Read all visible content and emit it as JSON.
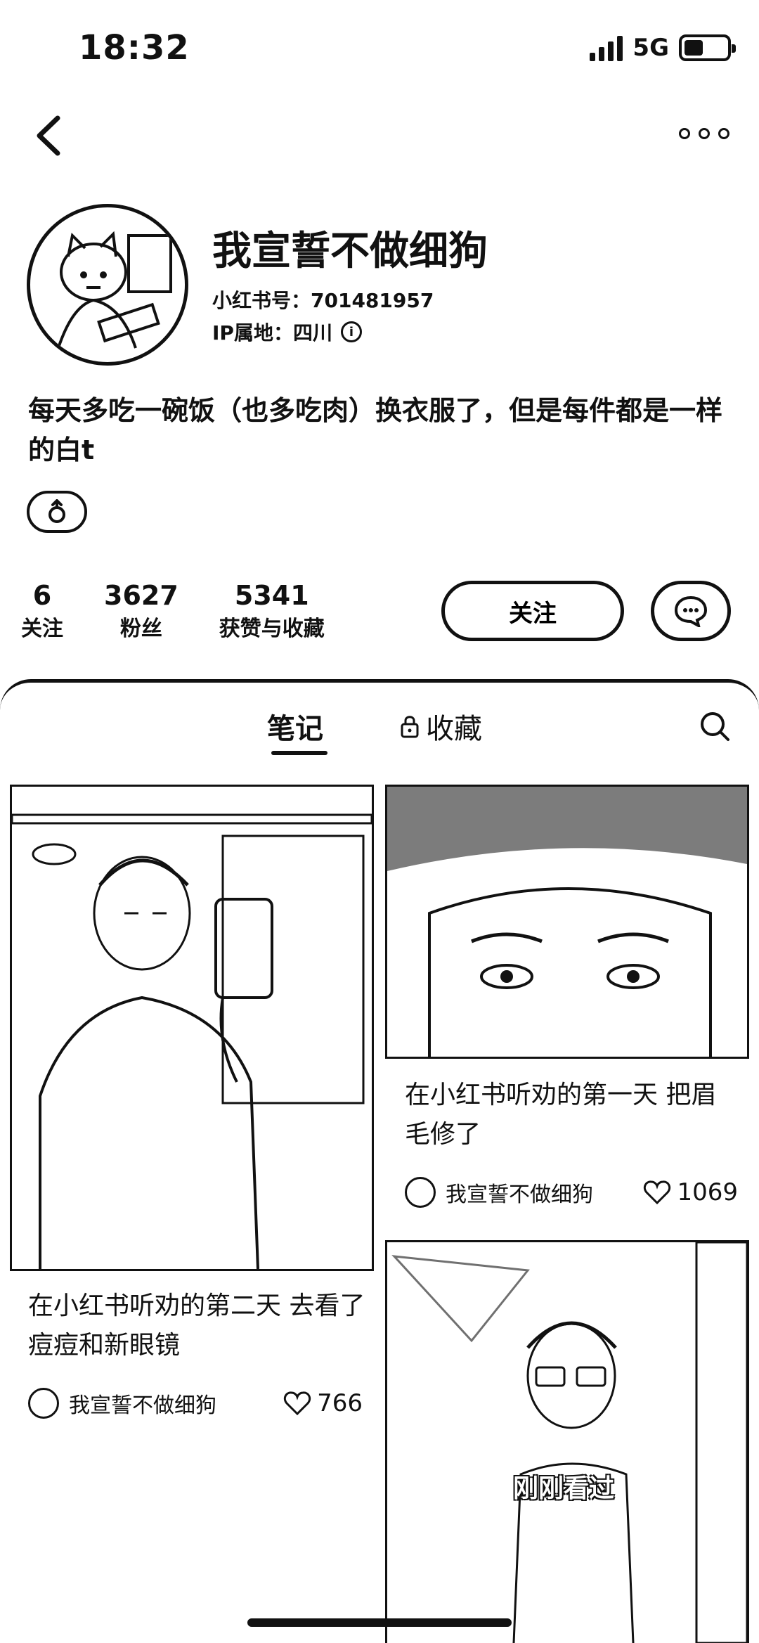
{
  "status_bar": {
    "time": "18:32",
    "network": "5G"
  },
  "profile": {
    "nickname": "我宣誓不做细狗",
    "red_id": "小红书号：701481957",
    "ip_location": "IP属地：四川",
    "bio": "每天多吃一碗饭（也多吃肉）换衣服了，但是每件都是一样的白t",
    "tag_icon": "gender-male-icon"
  },
  "stats": [
    {
      "value": "6",
      "label": "关注"
    },
    {
      "value": "3627",
      "label": "粉丝"
    },
    {
      "value": "5341",
      "label": "获赞与收藏"
    }
  ],
  "actions": {
    "follow_label": "关注",
    "chat_icon": "chat-icon"
  },
  "tabs": {
    "notes": "笔记",
    "collections": "收藏"
  },
  "notes": [
    {
      "title": "在小红书听劝的第二天 去看了痘痘和新眼镜",
      "author": "我宣誓不做细狗",
      "likes": "766"
    },
    {
      "title": "在小红书听劝的第一天 把眉毛修了",
      "author": "我宣誓不做细狗",
      "likes": "1069"
    }
  ],
  "recent_badge": "刚刚看过"
}
